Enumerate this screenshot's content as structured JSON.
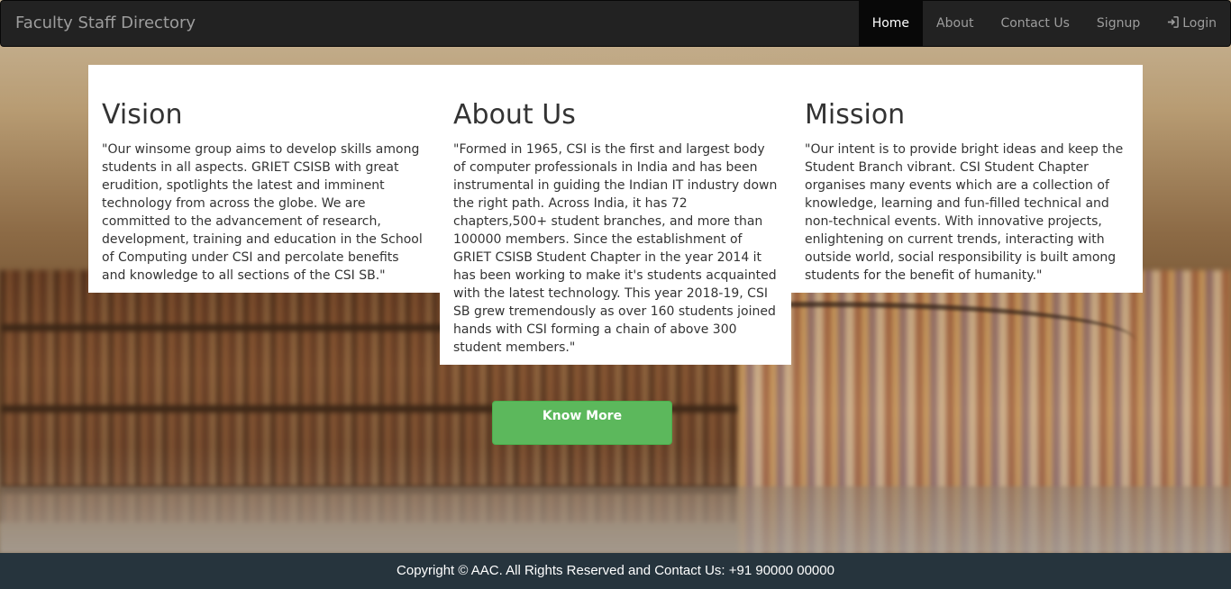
{
  "navbar": {
    "brand": "Faculty Staff Directory",
    "items": [
      {
        "label": "Home",
        "active": true
      },
      {
        "label": "About"
      },
      {
        "label": "Contact Us"
      },
      {
        "label": "Signup"
      },
      {
        "label": "Login",
        "icon": "login-icon"
      }
    ]
  },
  "panels": {
    "vision": {
      "title": "Vision",
      "text": "\"Our winsome group aims to develop skills among students in all aspects. GRIET CSISB with great erudition, spotlights the latest and imminent technology from across the globe. We are committed to the advancement of research, development, training and education in the School of Computing under CSI and percolate benefits and knowledge to all sections of the CSI SB.\""
    },
    "about": {
      "title": "About Us",
      "text": "\"Formed in 1965, CSI is the first and largest body of computer professionals in India and has been instrumental in guiding the Indian IT industry down the right path. Across India, it has 72 chapters,500+ student branches, and more than 100000 members. Since the establishment of GRIET CSISB Student Chapter in the year 2014 it has been working to make it's students acquainted with the latest technology. This year 2018-19, CSI SB grew tremendously as over 160 students joined hands with CSI forming a chain of above 300 student members.\""
    },
    "mission": {
      "title": "Mission",
      "text": "\"Our intent is to provide bright ideas and keep the Student Branch vibrant. CSI Student Chapter organises many events which are a collection of knowledge, learning and fun-filled technical and non-technical events. With innovative projects, enlightening on current trends, interacting with outside world, social responsibility is built among students for the benefit of humanity.\""
    }
  },
  "cta": {
    "label": "Know More",
    "color": "#5cb85c"
  },
  "footer": {
    "text": "Copyright © AAC. All Rights Reserved and Contact Us: +91 90000 00000"
  },
  "colors": {
    "navbar_bg": "#222222",
    "footer_bg": "#26343d",
    "active_nav": "#080808"
  }
}
